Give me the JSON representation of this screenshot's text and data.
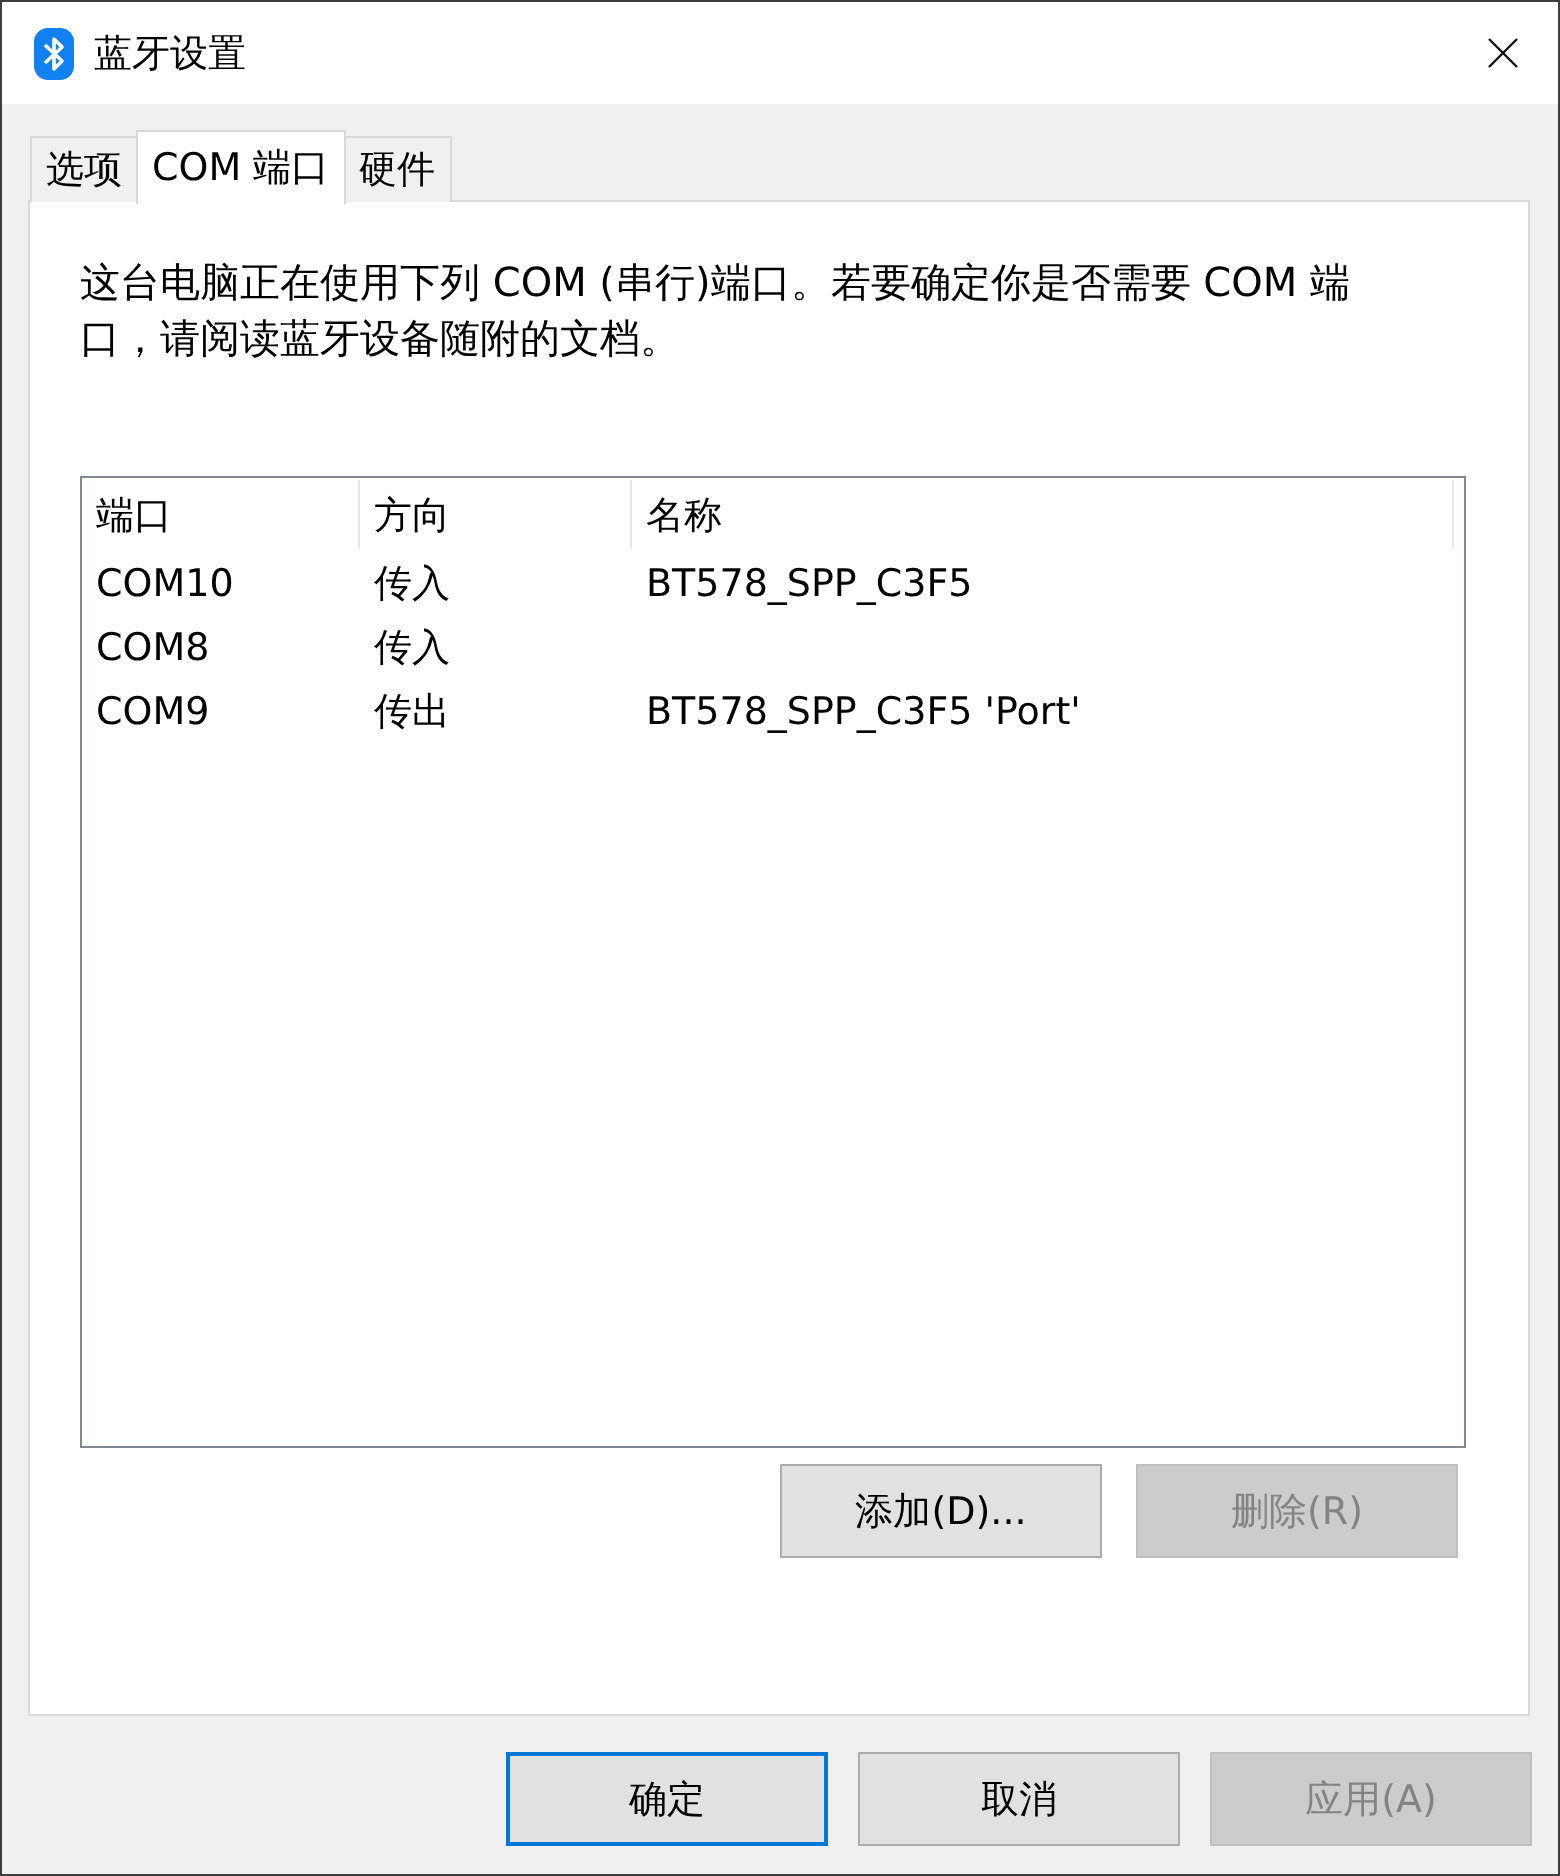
{
  "window": {
    "title": "蓝牙设置"
  },
  "tabs": [
    {
      "label": "选项",
      "selected": false
    },
    {
      "label": "COM 端口",
      "selected": true
    },
    {
      "label": "硬件",
      "selected": false
    }
  ],
  "description": "这台电脑正在使用下列 COM (串行)端口。若要确定你是否需要 COM 端口，请阅读蓝牙设备随附的文档。",
  "port_list": {
    "columns": [
      "端口",
      "方向",
      "名称"
    ],
    "rows": [
      {
        "cells": [
          "COM10",
          "传入",
          "BT578_SPP_C3F5"
        ]
      },
      {
        "cells": [
          "COM8",
          "传入"
        ]
      },
      {
        "cells": [
          "COM9",
          "传出",
          "BT578_SPP_C3F5 'Port'"
        ]
      }
    ]
  },
  "list_buttons": [
    {
      "label": "添加(D)...",
      "disabled": false
    },
    {
      "label": "删除(R)",
      "disabled": true
    }
  ],
  "dialog_buttons": [
    {
      "label": "确定",
      "default": true,
      "disabled": false
    },
    {
      "label": "取消",
      "default": false,
      "disabled": false
    },
    {
      "label": "应用(A)",
      "default": false,
      "disabled": true
    }
  ]
}
